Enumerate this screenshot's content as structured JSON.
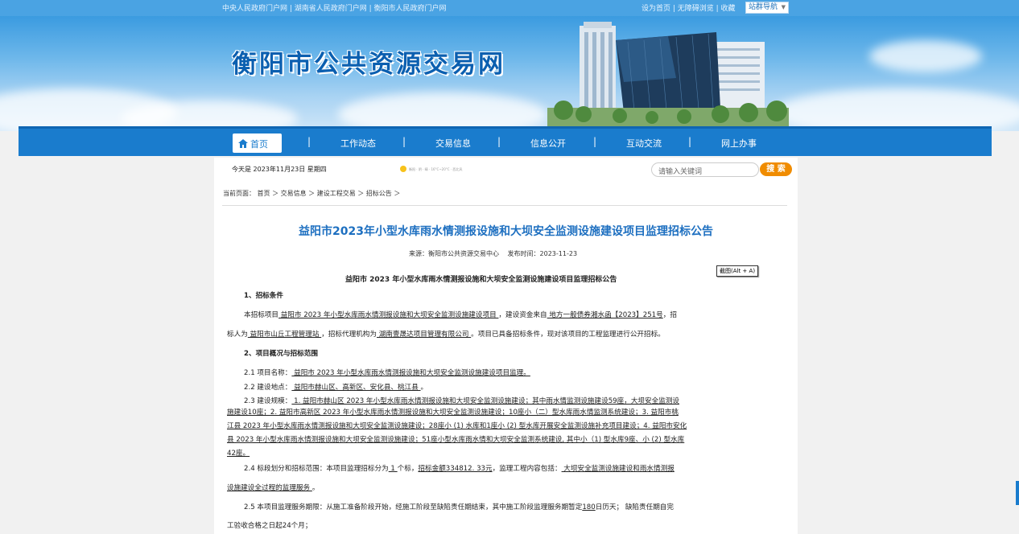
{
  "topbar": {
    "left_links": "中央人民政府门户网 | 湖南省人民政府门户网 | 衡阳市人民政府门户网",
    "right_links": "设为首页 | 无障碍浏览 | 收藏",
    "site_nav": "站群导航"
  },
  "banner": {
    "title": "衡阳市公共资源交易网"
  },
  "nav": {
    "home": "首页",
    "items": [
      "工作动态",
      "交易信息",
      "信息公开",
      "互动交流",
      "网上办事"
    ],
    "separator": "|"
  },
  "strip": {
    "date": "今天是 2023年11月23日 星期四",
    "weather": "衡阳 · 阴 · 晴 · 16°C~20°C · 西北风",
    "search_placeholder": "请输入关键词",
    "search_button": "搜 索"
  },
  "breadcrumb": "当前页面： 首页 ＞ 交易信息 ＞ 建设工程交易 ＞ 招标公告 ＞",
  "article": {
    "title": "益阳市2023年小型水库雨水情测报设施和大坝安全监测设施建设项目监理招标公告",
    "meta": "来源：衡阳市公共资源交易中心　 发布时间：2023-11-23",
    "screenshot_tip": "截图(Alt + A)",
    "subtitle": "益阳市 2023 年小型水库雨水情测报设施和大坝安全监测设施建设项目监理招标公告",
    "s1_heading": "1、招标条件",
    "s1_l1_a": "本招标项目",
    "s1_l1_u1": " 益阳市 2023 年小型水库雨水情测报设施和大坝安全监测设施建设项目 ",
    "s1_l1_b": "，建设资金来自",
    "s1_l1_u2": " 地方一般债券湘水函【2023】251号",
    "s1_l1_c": "，招",
    "s1_l2_a": "标人为",
    "s1_l2_u1": " 益阳市山丘工程管理站 ",
    "s1_l2_b": "，招标代理机构为",
    "s1_l2_u2": " 湖南壹晟达项目管理有限公司 ",
    "s1_l2_c": "。项目已具备招标条件，现对该项目的工程监理进行公开招标。",
    "s2_heading": "2、项目概况与招标范围",
    "s2_1_label": "2.1 项目名称：",
    "s2_1_value": "  益阳市 2023 年小型水库雨水情测报设施和大坝安全监测设施建设项目监理。",
    "s2_2_label": "2.2 建设地点：",
    "s2_2_value": " 益阳市赫山区、高新区、安化县、桃江县 ",
    "s2_2_end": "。",
    "s2_3_label": "2.3 建设规模：",
    "s2_3_l1": " 1. 益阳市赫山区 2023 年小型水库雨水情测报设施和大坝安全监测设施建设；其中雨水情监测设施建设59座，大坝安全监测设",
    "s2_3_l2": "施建设10座；2. 益阳市高新区 2023 年小型水库雨水情测报设施和大坝安全监测设施建设；10座小（二）型水库雨水情监测系统建设；3. 益阳市桃",
    "s2_3_l3": "江县 2023 年小型水库雨水情测报设施和大坝安全监测设施建设；28座小 (1) 水库和1座小 (2) 型水库开展安全监测设施补充项目建设；4. 益阳市安化",
    "s2_3_l4": "县 2023 年小型水库雨水情测报设施和大坝安全监测设施建设；51座小型水库雨水情和大坝安全监测系统建设, 其中小（1) 型水库9座、小 (2) 型水库",
    "s2_3_l5": "42座。",
    "s2_4_a": "2.4 标段划分和招标范围：本项目监理招标分为",
    "s2_4_u1": "  1  ",
    "s2_4_b": "个标，",
    "s2_4_u2": "招标金额334812. 33元",
    "s2_4_c": "，监理工程内容包括：",
    "s2_4_u3": " 大坝安全监测设施建设和雨水情测报",
    "s2_4_l2_u": "设施建设全过程的监理服务 ",
    "s2_4_l2_end": "。",
    "s2_5_a": "2.5 本项目监理服务期限：从施工准备阶段开始，经施工阶段至缺陷责任期结束，其中施工阶段监理服务期暂定",
    "s2_5_u": "180",
    "s2_5_b": "日历天；  缺陷责任期自完",
    "s2_5_l2": "工验收合格之日起24个月；"
  },
  "colors": {
    "nav": "#1a7ccd",
    "title": "#1d6fc0",
    "search_button": "#f08c00"
  }
}
